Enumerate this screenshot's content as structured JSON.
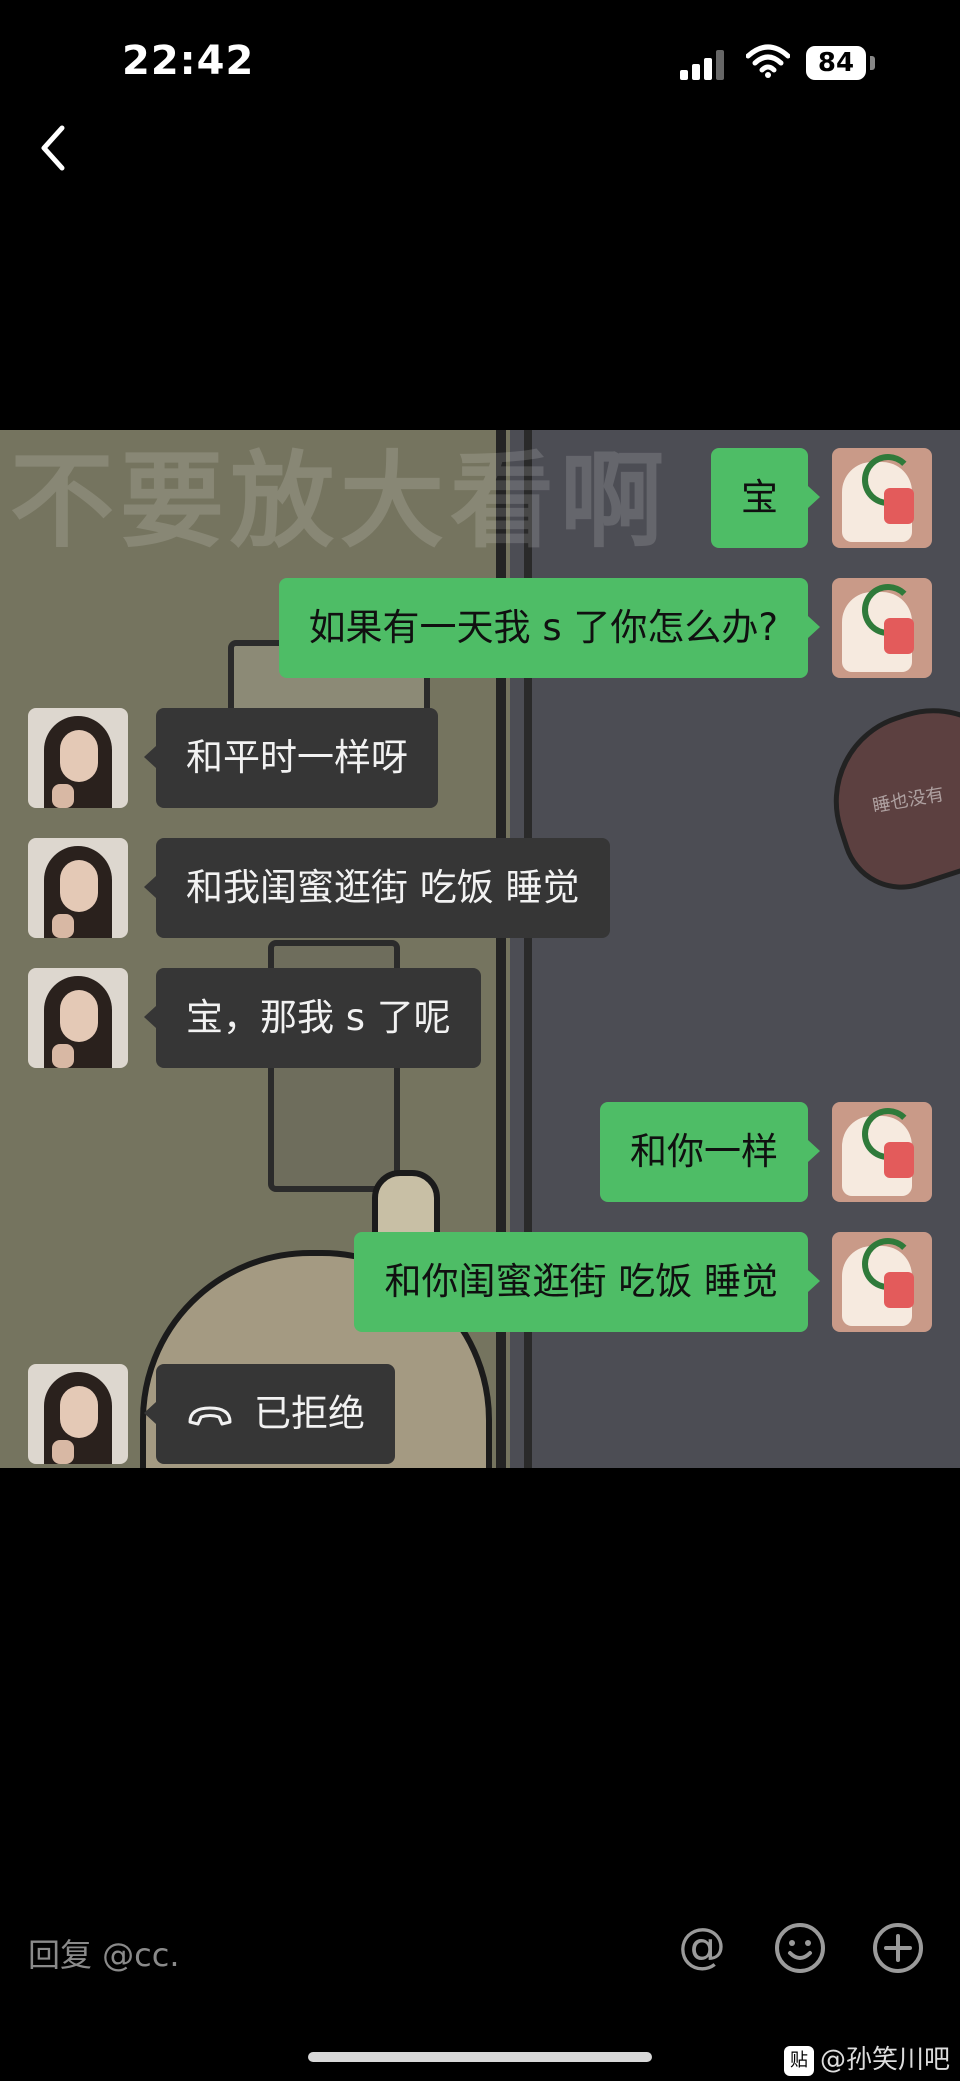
{
  "status_bar": {
    "time": "22:42",
    "battery": "84"
  },
  "photo": {
    "watermark": "不要放大看啊",
    "heart_text": "睡也没有",
    "messages": [
      {
        "side": "me",
        "text": "宝"
      },
      {
        "side": "me",
        "text": "如果有一天我 s 了你怎么办?"
      },
      {
        "side": "them",
        "text": "和平时一样呀"
      },
      {
        "side": "them",
        "text": "和我闺蜜逛街 吃饭 睡觉"
      },
      {
        "side": "them",
        "text": "宝，那我 s 了呢"
      },
      {
        "side": "me",
        "text": "和你一样"
      },
      {
        "side": "me",
        "text": "和你闺蜜逛街 吃饭 睡觉"
      },
      {
        "side": "them",
        "text": "已拒绝",
        "type": "call"
      }
    ]
  },
  "reply": {
    "placeholder": "回复 @cc."
  },
  "source": {
    "logo": "贴",
    "label": "@孙笑川吧"
  },
  "colors": {
    "bubble_me": "#4ebd66",
    "bubble_them": "#363636",
    "background": "#000000"
  }
}
